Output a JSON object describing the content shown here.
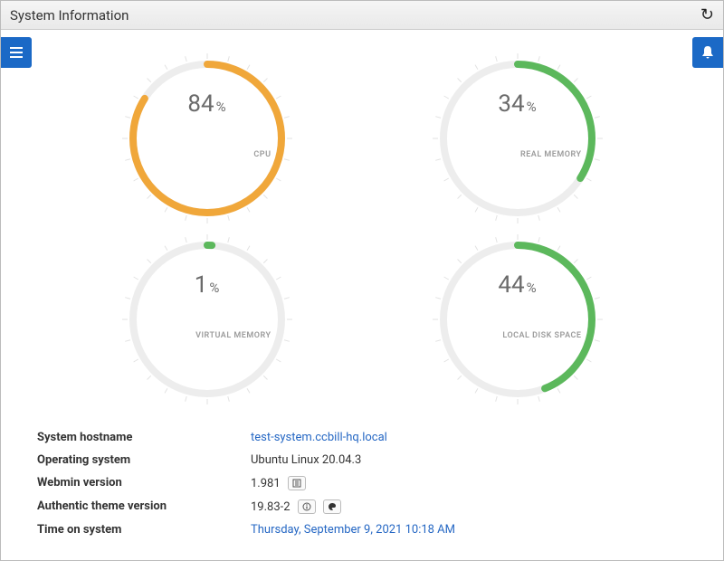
{
  "header": {
    "title": "System Information",
    "refresh_glyph": "↻"
  },
  "gauges": [
    {
      "value": 84,
      "label": "CPU",
      "color": "#f0a73a"
    },
    {
      "value": 34,
      "label": "REAL MEMORY",
      "color": "#5cb85c"
    },
    {
      "value": 1,
      "label": "VIRTUAL MEMORY",
      "color": "#5cb85c"
    },
    {
      "value": 44,
      "label": "LOCAL DISK SPACE",
      "color": "#5cb85c"
    }
  ],
  "info": {
    "hostname_label": "System hostname",
    "hostname_value": "test-system.ccbill-hq.local",
    "os_label": "Operating system",
    "os_value": "Ubuntu Linux 20.04.3",
    "webmin_label": "Webmin version",
    "webmin_value": "1.981",
    "theme_label": "Authentic theme version",
    "theme_value": "19.83-2",
    "time_label": "Time on system",
    "time_value": "Thursday, September 9, 2021 10:18 AM"
  },
  "chart_data": [
    {
      "type": "gauge",
      "title": "CPU",
      "value": 84,
      "min": 0,
      "max": 100,
      "unit": "%"
    },
    {
      "type": "gauge",
      "title": "REAL MEMORY",
      "value": 34,
      "min": 0,
      "max": 100,
      "unit": "%"
    },
    {
      "type": "gauge",
      "title": "VIRTUAL MEMORY",
      "value": 1,
      "min": 0,
      "max": 100,
      "unit": "%"
    },
    {
      "type": "gauge",
      "title": "LOCAL DISK SPACE",
      "value": 44,
      "min": 0,
      "max": 100,
      "unit": "%"
    }
  ]
}
